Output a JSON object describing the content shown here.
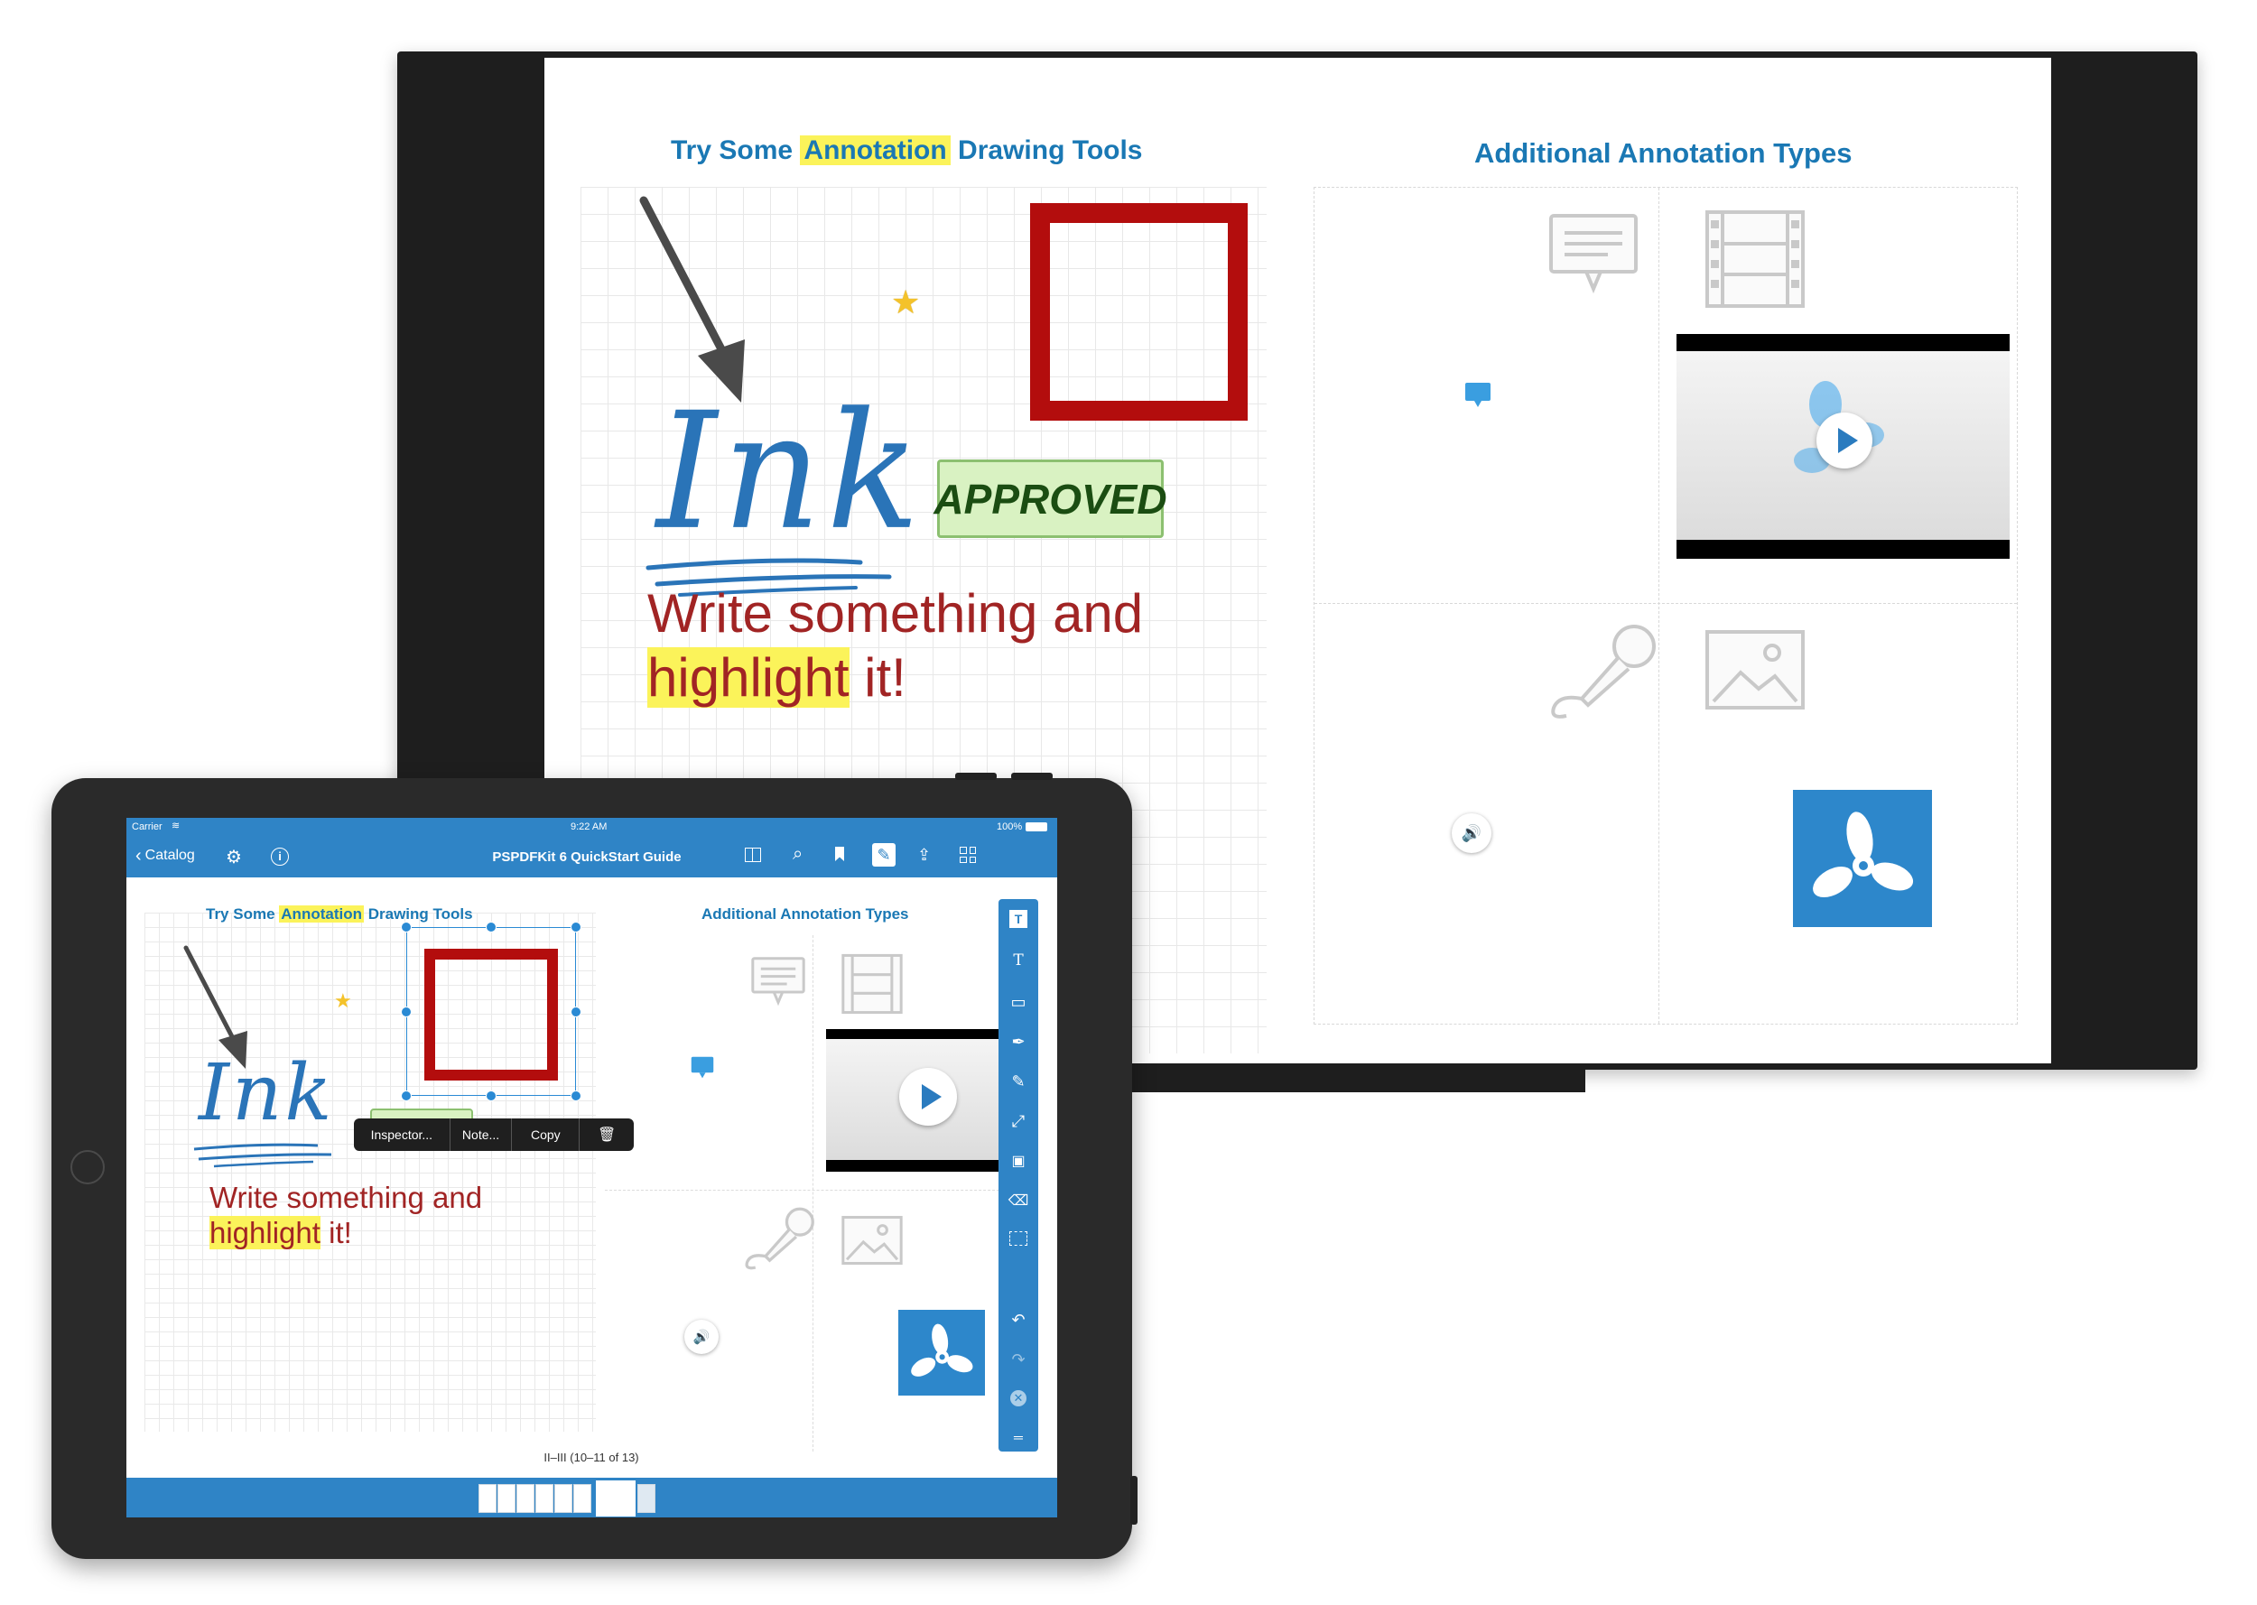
{
  "colors": {
    "accent": "#2a7bbf",
    "toolbar": "#2f84c6",
    "section_title": "#1a78b4",
    "write_red": "#a12424",
    "highlight": "#fbf35a",
    "square_red": "#b30d0d"
  },
  "monitor": {
    "page_left": {
      "title_pre": "Try Some",
      "title_hl": "Annotation",
      "title_post": "Drawing Tools",
      "ink_text": "Ink",
      "stamp": "APPROVED",
      "write_line1": "Write something and",
      "write_hl": "highlight",
      "write_post": " it!"
    },
    "page_right": {
      "title": "Additional Annotation Types"
    }
  },
  "tablet": {
    "status": {
      "carrier": "Carrier",
      "time": "9:22 AM",
      "battery": "100%"
    },
    "nav": {
      "back_label": "Catalog",
      "title": "PSPDFKit 6 QuickStart Guide"
    },
    "page_left": {
      "title_pre": "Try Some",
      "title_hl": "Annotation",
      "title_post": "Drawing Tools",
      "ink_text": "Ink",
      "write_line1": "Write something and",
      "write_hl": "highlight",
      "write_post": " it!"
    },
    "page_right": {
      "title": "Additional Annotation Types"
    },
    "context_menu": {
      "inspector": "Inspector...",
      "note": "Note...",
      "copy": "Copy"
    },
    "page_label": "II–III (10–11 of 13)"
  }
}
